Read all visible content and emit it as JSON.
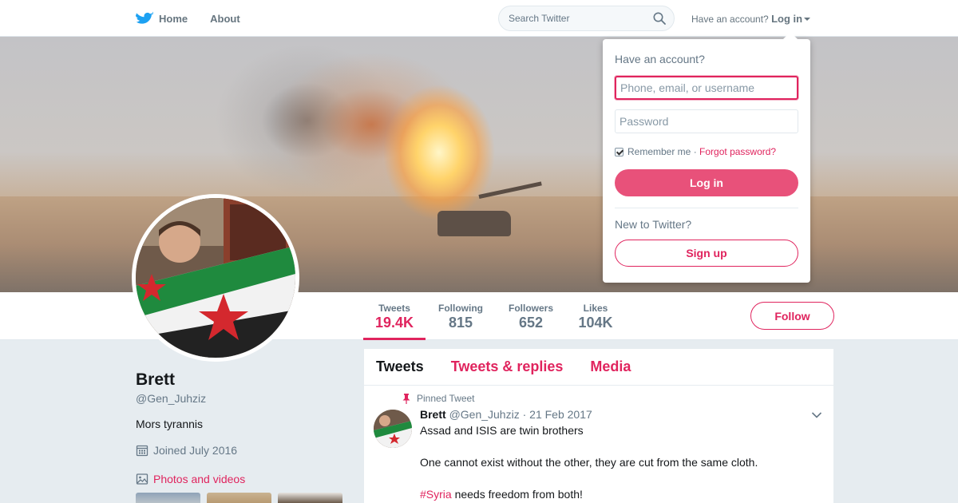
{
  "nav": {
    "home_label": "Home",
    "about_label": "About",
    "search_placeholder": "Search Twitter",
    "have_account": "Have an account?",
    "login_label": "Log in"
  },
  "login_dropdown": {
    "title": "Have an account?",
    "username_placeholder": "Phone, email, or username",
    "password_placeholder": "Password",
    "remember_me": "Remember me",
    "separator": "·",
    "forgot_password": "Forgot password?",
    "login_button": "Log in",
    "new_prompt": "New to Twitter?",
    "signup_button": "Sign up"
  },
  "stats": [
    {
      "label": "Tweets",
      "value": "19.4K",
      "active": true
    },
    {
      "label": "Following",
      "value": "815",
      "active": false
    },
    {
      "label": "Followers",
      "value": "652",
      "active": false
    },
    {
      "label": "Likes",
      "value": "104K",
      "active": false
    }
  ],
  "follow_button": "Follow",
  "profile": {
    "name": "Brett",
    "handle": "@Gen_Juhziz",
    "bio": "Mors tyrannis",
    "joined": "Joined July 2016",
    "photos_link": "Photos and videos"
  },
  "timeline": {
    "tabs": [
      "Tweets",
      "Tweets & replies",
      "Media"
    ],
    "pinned_label": "Pinned Tweet",
    "tweet": {
      "name": "Brett",
      "handle": "@Gen_Juhziz",
      "date": "· 21 Feb 2017",
      "line1": "Assad and ISIS are twin brothers",
      "line2": "One cannot exist without the other, they are cut from the same cloth.",
      "hashtag": "#Syria",
      "line3_rest": " needs freedom from both!"
    }
  },
  "colors": {
    "accent": "#e0245e",
    "twitter_blue": "#1da1f2",
    "text_secondary": "#657786"
  }
}
